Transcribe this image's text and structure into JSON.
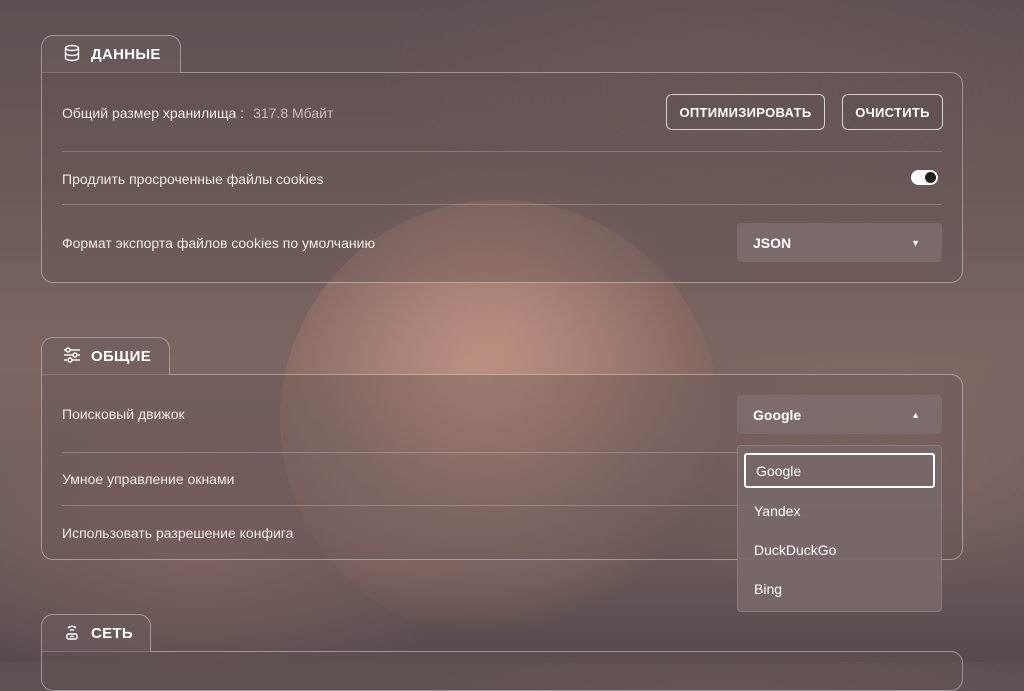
{
  "data_section": {
    "title": "ДАННЫЕ",
    "icon": "database-icon",
    "storage_label": "Общий размер хранилища :",
    "storage_value": "317.8 Мбайт",
    "optimize_button": "ОПТИМИЗИРОВАТЬ",
    "clear_button": "ОЧИСТИТЬ",
    "extend_cookies_label": "Продлить просроченные файлы cookies",
    "extend_cookies_enabled": true,
    "export_format_label": "Формат экспорта файлов cookies по умолчанию",
    "export_format_value": "JSON"
  },
  "general_section": {
    "title": "ОБЩИЕ",
    "icon": "sliders-icon",
    "search_engine_label": "Поисковый движок",
    "search_engine_value": "Google",
    "search_engine_options": [
      "Google",
      "Yandex",
      "DuckDuckGo",
      "Bing"
    ],
    "smart_windows_label": "Умное управление окнами",
    "config_resolution_label": "Использовать разрешение конфига"
  },
  "network_section": {
    "title": "СЕТЬ",
    "icon": "network-icon"
  }
}
